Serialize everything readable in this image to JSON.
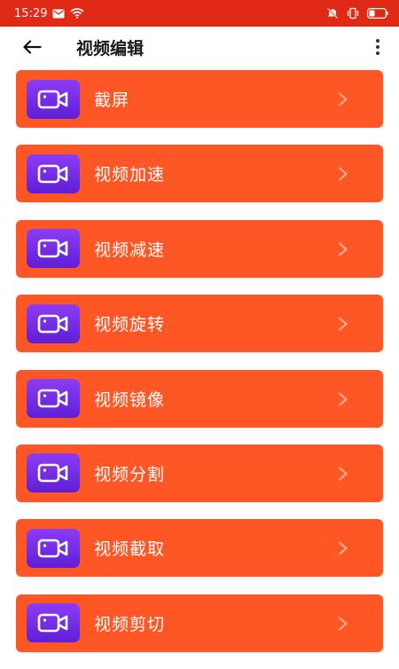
{
  "status": {
    "time": "15:29"
  },
  "header": {
    "title": "视频编辑"
  },
  "colors": {
    "status_bar": "#e02a16",
    "item_background": "#fe5725",
    "icon_gradient_top": "#8d3cf5",
    "icon_gradient_bottom": "#5e1fd6"
  },
  "items": [
    {
      "label": "截屏",
      "icon": "video-camera-icon"
    },
    {
      "label": "视频加速",
      "icon": "video-camera-icon"
    },
    {
      "label": "视频减速",
      "icon": "video-camera-icon"
    },
    {
      "label": "视频旋转",
      "icon": "video-camera-icon"
    },
    {
      "label": "视频镜像",
      "icon": "video-camera-icon"
    },
    {
      "label": "视频分割",
      "icon": "video-camera-icon"
    },
    {
      "label": "视频截取",
      "icon": "video-camera-icon"
    },
    {
      "label": "视频剪切",
      "icon": "video-camera-icon"
    }
  ]
}
